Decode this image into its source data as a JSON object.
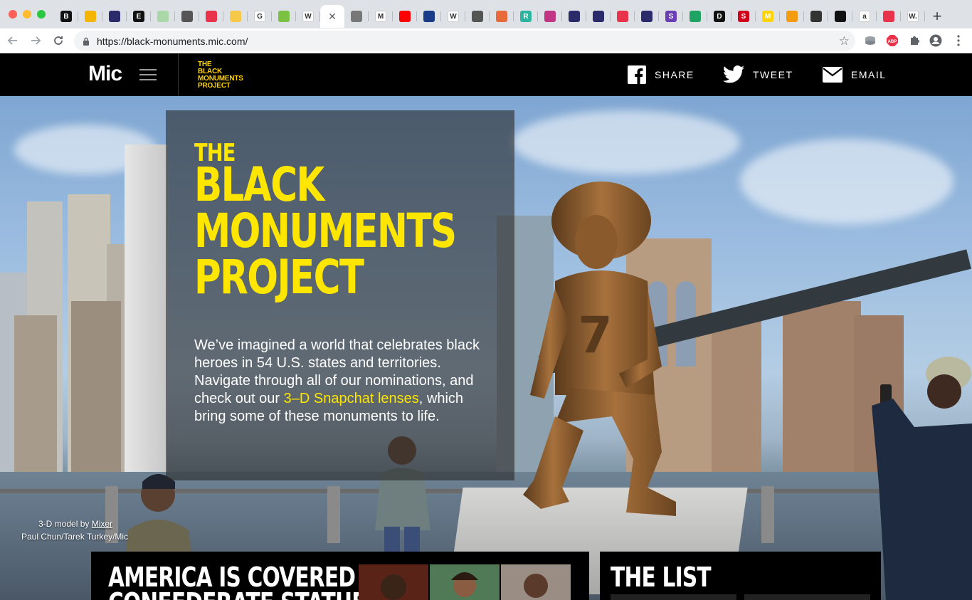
{
  "browser": {
    "url": "https://black-monuments.mic.com/",
    "tabs": [
      {
        "icon": "b-icon",
        "color": "#111111",
        "glyph": "B"
      },
      {
        "icon": "slides-icon",
        "color": "#f4b400",
        "glyph": ""
      },
      {
        "icon": "bird-icon",
        "color": "#2b2b6b",
        "glyph": ""
      },
      {
        "icon": "e-icon",
        "color": "#111111",
        "glyph": "E"
      },
      {
        "icon": "sheet-icon",
        "color": "#a8d8a8",
        "glyph": ""
      },
      {
        "icon": "globe-icon",
        "color": "#555555",
        "glyph": ""
      },
      {
        "icon": "pocket-icon",
        "color": "#e8334a",
        "glyph": ""
      },
      {
        "icon": "cc-icon",
        "color": "#f7c948",
        "glyph": ""
      },
      {
        "icon": "google-icon",
        "color": "#ffffff",
        "glyph": "G"
      },
      {
        "icon": "feedly-icon",
        "color": "#7cc242",
        "glyph": ""
      },
      {
        "icon": "wikipedia-icon",
        "color": "#ffffff",
        "glyph": "W"
      },
      {
        "icon": "active-tab-icon",
        "color": "#ffffff",
        "glyph": ""
      },
      {
        "icon": "globe-icon",
        "color": "#777777",
        "glyph": ""
      },
      {
        "icon": "medium-icon",
        "color": "#ffffff",
        "glyph": "M"
      },
      {
        "icon": "youtube-icon",
        "color": "#ff0000",
        "glyph": ""
      },
      {
        "icon": "dot-icon",
        "color": "#1a3a8a",
        "glyph": ""
      },
      {
        "icon": "wikipedia-icon",
        "color": "#ffffff",
        "glyph": "W"
      },
      {
        "icon": "globe-icon",
        "color": "#555555",
        "glyph": ""
      },
      {
        "icon": "grid-icon",
        "color": "#e86a3a",
        "glyph": ""
      },
      {
        "icon": "r-icon",
        "color": "#2bb5a0",
        "glyph": "R"
      },
      {
        "icon": "instagram-icon",
        "color": "#c13584",
        "glyph": ""
      },
      {
        "icon": "bird-icon",
        "color": "#2b2b6b",
        "glyph": ""
      },
      {
        "icon": "bird-icon",
        "color": "#2b2b6b",
        "glyph": ""
      },
      {
        "icon": "o-icon",
        "color": "#e8334a",
        "glyph": ""
      },
      {
        "icon": "bird-icon",
        "color": "#2b2b6b",
        "glyph": ""
      },
      {
        "icon": "s-icon",
        "color": "#6a3fb5",
        "glyph": "S"
      },
      {
        "icon": "drive-icon",
        "color": "#1fa463",
        "glyph": ""
      },
      {
        "icon": "d-icon",
        "color": "#111111",
        "glyph": "D"
      },
      {
        "icon": "s-red-icon",
        "color": "#d0021b",
        "glyph": "S"
      },
      {
        "icon": "m-yellow-icon",
        "color": "#ffd400",
        "glyph": "M"
      },
      {
        "icon": "grid-orange-icon",
        "color": "#f39c12",
        "glyph": ""
      },
      {
        "icon": "diamond-icon",
        "color": "#333333",
        "glyph": ""
      },
      {
        "icon": "circle-black-icon",
        "color": "#111111",
        "glyph": ""
      },
      {
        "icon": "amazon-icon",
        "color": "#ffffff",
        "glyph": "a"
      },
      {
        "icon": "target-icon",
        "color": "#e8334a",
        "glyph": ""
      },
      {
        "icon": "w-icon",
        "color": "#ffffff",
        "glyph": "W."
      }
    ]
  },
  "header": {
    "logo": "Mic",
    "project_logo": [
      "THE",
      "BLACK",
      "MONUMENTS",
      "PROJECT"
    ],
    "share_label": "SHARE",
    "tweet_label": "TWEET",
    "email_label": "EMAIL"
  },
  "hero": {
    "title_small": "THE",
    "title_lines": [
      "BLACK",
      "MONUMENTS",
      "PROJECT"
    ],
    "desc_before": "We’ve imagined a world that celebrates black heroes in 54 U.S. states and territories. Navigate through all of our nominations, and check out our ",
    "desc_link": "3–D Snapchat lenses",
    "desc_after": ", which bring some of these monuments to life.",
    "credit_prefix": "3-D model by ",
    "credit_link": "Mixer",
    "credit_photo": "Paul Chun/Tarek Turkey/Mic"
  },
  "cards": {
    "america_title": [
      "AMERICA IS COVERED IN",
      "CONFEDERATE STATUES"
    ],
    "list_title": "THE LIST"
  },
  "colors": {
    "accent": "#ffe600",
    "header_bg": "#000000"
  }
}
